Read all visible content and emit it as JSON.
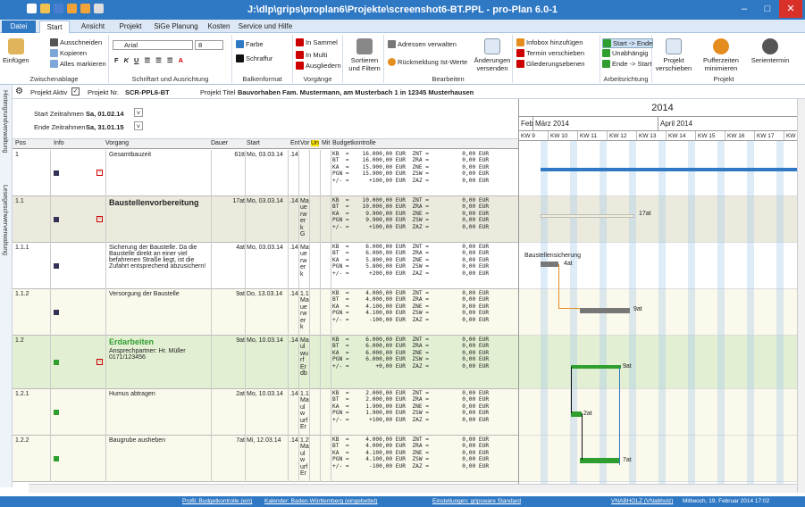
{
  "window": {
    "title": "J:\\dlp\\grips\\proplan6\\Projekte\\screenshot6-BT.PPL - pro-Plan 6.0-1",
    "minimize": "–",
    "maximize": "□",
    "close": "✕"
  },
  "ribbon_tabs": [
    "Datei",
    "Start",
    "Ansicht",
    "Projekt",
    "SiGe Planung",
    "Kosten",
    "Service und Hilfe"
  ],
  "ribbon": {
    "clipboard": {
      "paste": "Einfügen",
      "cut": "Ausschneiden",
      "copy": "Kopieren",
      "select_all": "Alles markieren",
      "group": "Zwischenablage"
    },
    "font": {
      "family": "Arial",
      "size": "8",
      "group": "Schriftart und Ausrichtung"
    },
    "bars": {
      "color": "Farbe",
      "hatch": "Schraffur",
      "group": "Balkenformat"
    },
    "process": {
      "in_collection": "In Sammel",
      "in_multi": "In Multi",
      "outdent": "Ausgliedern",
      "group": "Vorgänge"
    },
    "sort": {
      "label": "Sortieren und Filtern"
    },
    "edit": {
      "addresses": "Adressen verwalten",
      "feedback": "Rückmeldung Ist-Werte",
      "send_changes": "Änderungen versenden",
      "group": "Bearbeiten"
    },
    "infobox": {
      "add": "Infobox hinzufügen",
      "move": "Termin verschieben",
      "levels": "Gliederungsebenen"
    },
    "direction": {
      "start_end": "Start -> Ende",
      "independent": "Unabhängig",
      "end_start": "Ende -> Start",
      "group": "Arbeitsrichtung"
    },
    "project": {
      "shift": "Projekt verschieben",
      "buffer": "Pufferzeiten minimieren",
      "series": "Serientermin",
      "group": "Projekt"
    }
  },
  "sidebar": {
    "tab1": "Hintergrundverwaltung",
    "tab2": "Lesegeschwerverwaltung"
  },
  "project_bar": {
    "active_label": "Projekt Aktiv",
    "nr_label": "Projekt Nr.",
    "nr": "SCR-PPL6-BT",
    "title_label": "Projekt Titel",
    "title": "Bauvorhaben Fam. Mustermann, am Musterbach 1 in 12345 Musterhausen"
  },
  "timeframe": {
    "start_label": "Start Zeitrahmen",
    "start": "Sa, 01.02.14",
    "end_label": "Ende Zeitrahmen",
    "end": "Sa, 31.01.15"
  },
  "columns": [
    "Pos",
    "Info",
    "Vorgang",
    "Dauer",
    "Start",
    "Ent",
    "Vor",
    "Un",
    "Mit",
    "Budgetkontrolle"
  ],
  "rows": [
    {
      "pos": "1",
      "name": "Gesamtbauzeit",
      "dur": "61tt",
      "start": "Mo, 03.03.14",
      "ent": ".14",
      "vor": "",
      "budget": "KB  =    16.000,00 EUR  ZNT =          0,00 EUR\nBT  =    16.000,00 EUR  ZRA =          0,00 EUR\nKA  =    15.900,00 EUR  ZNE =          0,00 EUR\nPGN =    15.900,00 EUR  ZSW =          0,00 EUR\n+/- =      +100,00 EUR  ZAZ =          0,00 EUR"
    },
    {
      "pos": "1.1",
      "name": "Baustellenvorbereitung",
      "dur": "17at",
      "start": "Mo, 03.03.14",
      "ent": ".14",
      "vor": "Ma\nue\nrw\ner\nk\nG",
      "budget": "KB  =    10.000,00 EUR  ZNT =          0,00 EUR\nBT  =    10.000,00 EUR  ZRA =          0,00 EUR\nKA  =     9.900,00 EUR  ZNE =          0,00 EUR\nPGN =     9.900,00 EUR  ZSW =          0,00 EUR\n+/- =      +100,00 EUR  ZAZ =          0,00 EUR"
    },
    {
      "pos": "1.1.1",
      "name": "Sicherung der Baustelle. Da die Baustelle direkt an einer viel befahrenen Straße liegt, ist die Zufahrt entsprechend abzusichern!",
      "dur": "4at",
      "start": "Mo, 03.03.14",
      "ent": ".14",
      "vor": "Ma\nue\nrw\ner\nk",
      "budget": "KB  =     6.000,00 EUR  ZNT =          0,00 EUR\nBT  =     6.000,00 EUR  ZRA =          0,00 EUR\nKA  =     5.800,00 EUR  ZNE =          0,00 EUR\nPGN =     5.800,00 EUR  ZSW =          0,00 EUR\n+/- =      +200,00 EUR  ZAZ =          0,00 EUR"
    },
    {
      "pos": "1.1.2",
      "name": "Versorgung der Baustelle",
      "dur": "9at",
      "start": "Do, 13.03.14",
      "ent": ".14",
      "vor": "1.1\nMa\nue\nrw\ner\nk",
      "budget": "KB  =     4.000,00 EUR  ZNT =          0,00 EUR\nBT  =     4.000,00 EUR  ZRA =          0,00 EUR\nKA  =     4.100,00 EUR  ZNE =          0,00 EUR\nPGN =     4.100,00 EUR  ZSW =          0,00 EUR\n+/- =      -100,00 EUR  ZAZ =          0,00 EUR"
    },
    {
      "pos": "1.2",
      "name": "Erdarbeiten",
      "contact": "Ansprechpartner: Hr. Müller\n0171/123456",
      "dur": "9at",
      "start": "Mo, 10.03.14",
      "ent": ".14",
      "vor": "Ma\nul\nwu\nrf\nEr\ndb",
      "budget": "KB  =     6.000,00 EUR  ZNT =          0,00 EUR\nBT  =     6.000,00 EUR  ZRA =          0,00 EUR\nKA  =     6.000,00 EUR  ZNE =          0,00 EUR\nPGN =     6.000,00 EUR  ZSW =          0,00 EUR\n+/- =        +0,00 EUR  ZAZ =          0,00 EUR"
    },
    {
      "pos": "1.2.1",
      "name": "Humus abtragen",
      "dur": "2at",
      "start": "Mo, 10.03.14",
      "ent": ".14",
      "vor": "1.1\nMa\nul\nw\nurf\nEr",
      "budget": "KB  =     2.000,00 EUR  ZNT =          0,00 EUR\nBT  =     2.000,00 EUR  ZRA =          0,00 EUR\nKA  =     1.900,00 EUR  ZNE =          0,00 EUR\nPGN =     1.900,00 EUR  ZSW =          0,00 EUR\n+/- =      +100,00 EUR  ZAZ =          0,00 EUR"
    },
    {
      "pos": "1.2.2",
      "name": "Baugrube ausheben",
      "dur": "7at",
      "start": "Mi, 12.03.14",
      "ent": ".14",
      "vor": "1.2\nMa\nul\nw\nurf\nEr",
      "budget": "KB  =     4.000,00 EUR  ZNT =          0,00 EUR\nBT  =     4.000,00 EUR  ZRA =          0,00 EUR\nKA  =     4.100,00 EUR  ZNE =          0,00 EUR\nPGN =     4.100,00 EUR  ZSW =          0,00 EUR\n+/- =      -100,00 EUR  ZAZ =          0,00 EUR"
    }
  ],
  "gantt": {
    "year": "2014",
    "months": [
      "Feb",
      "März 2014",
      "April 2014"
    ],
    "weeks": [
      "KW 9",
      "KW 10",
      "KW 11",
      "KW 12",
      "KW 13",
      "KW 14",
      "KW 15",
      "KW 16",
      "KW 17",
      "KW"
    ],
    "labels": {
      "r1": "17at",
      "r2a": "Baustellensicherung",
      "r2b": "4at",
      "r3": "9at",
      "r4": "9at",
      "r5": "2at",
      "r6": "7at"
    }
  },
  "status": {
    "profile": "Profil: Budgetkontrolle (ein)",
    "calendar": "Kalender: Baden-Württemberg (eingebettet)",
    "settings": "Einstellungen: gripsware Standard",
    "user": "VNABHOLZ (VNabholz)",
    "datetime": "Mittwoch, 19. Februar 2014 17:02"
  },
  "colors": {
    "accent": "#2f78c4",
    "summary_bar": "#2f78c4",
    "green_bar": "#2e9e2e",
    "gray_bar": "#777777"
  }
}
